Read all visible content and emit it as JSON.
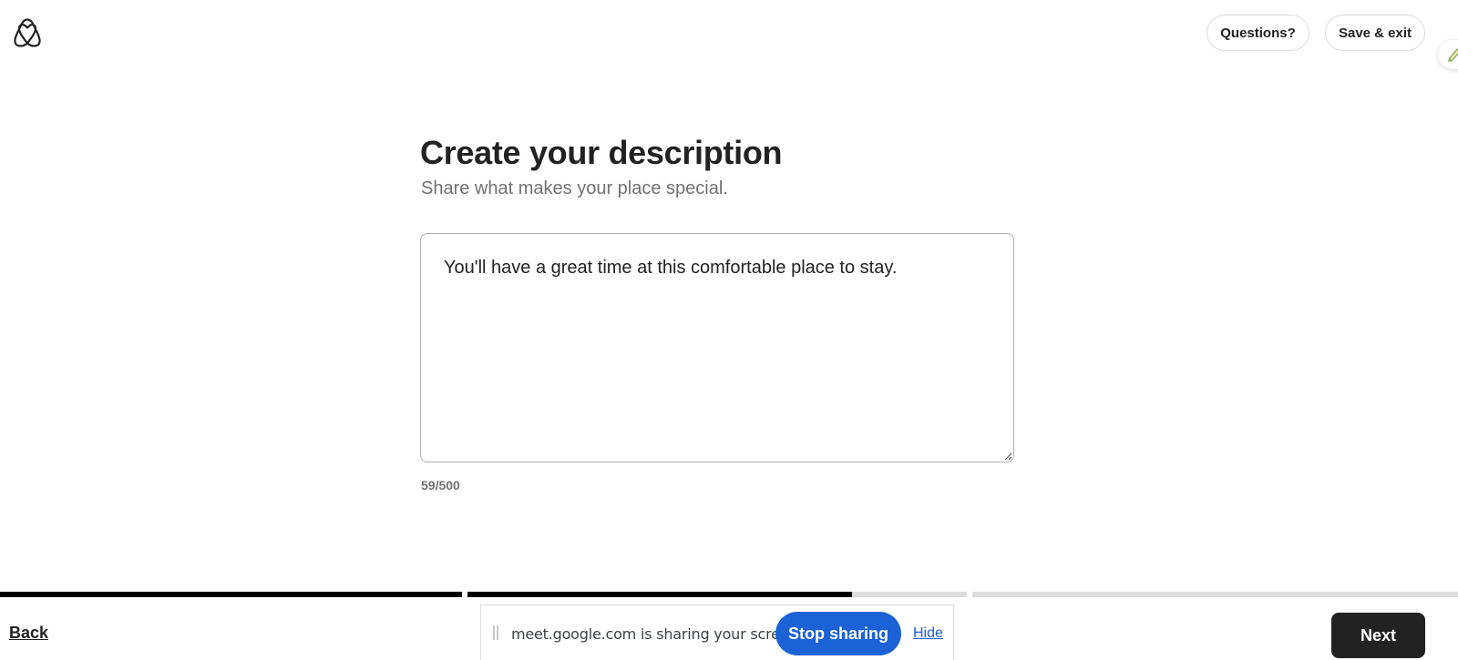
{
  "header": {
    "logo_icon": "airbnb-logo-icon",
    "questions_label": "Questions?",
    "save_exit_label": "Save & exit",
    "extension_icon": "browser-extension-icon"
  },
  "main": {
    "title": "Create your description",
    "subtitle": "Share what makes your place special.",
    "description_value": "You'll have a great time at this comfortable place to stay.",
    "char_count": "59/500"
  },
  "progress": {
    "segments": [
      {
        "fill": 1.0
      },
      {
        "fill": 0.77
      },
      {
        "fill": 0.0
      }
    ]
  },
  "footer": {
    "back_label": "Back",
    "next_label": "Next"
  },
  "screen_share": {
    "message": "meet.google.com is sharing your screen.",
    "stop_label": "Stop sharing",
    "hide_label": "Hide"
  },
  "colors": {
    "accent_dark": "#222222",
    "muted_text": "#717171",
    "share_blue": "#1a62d6",
    "progress_track": "#dddddd"
  }
}
